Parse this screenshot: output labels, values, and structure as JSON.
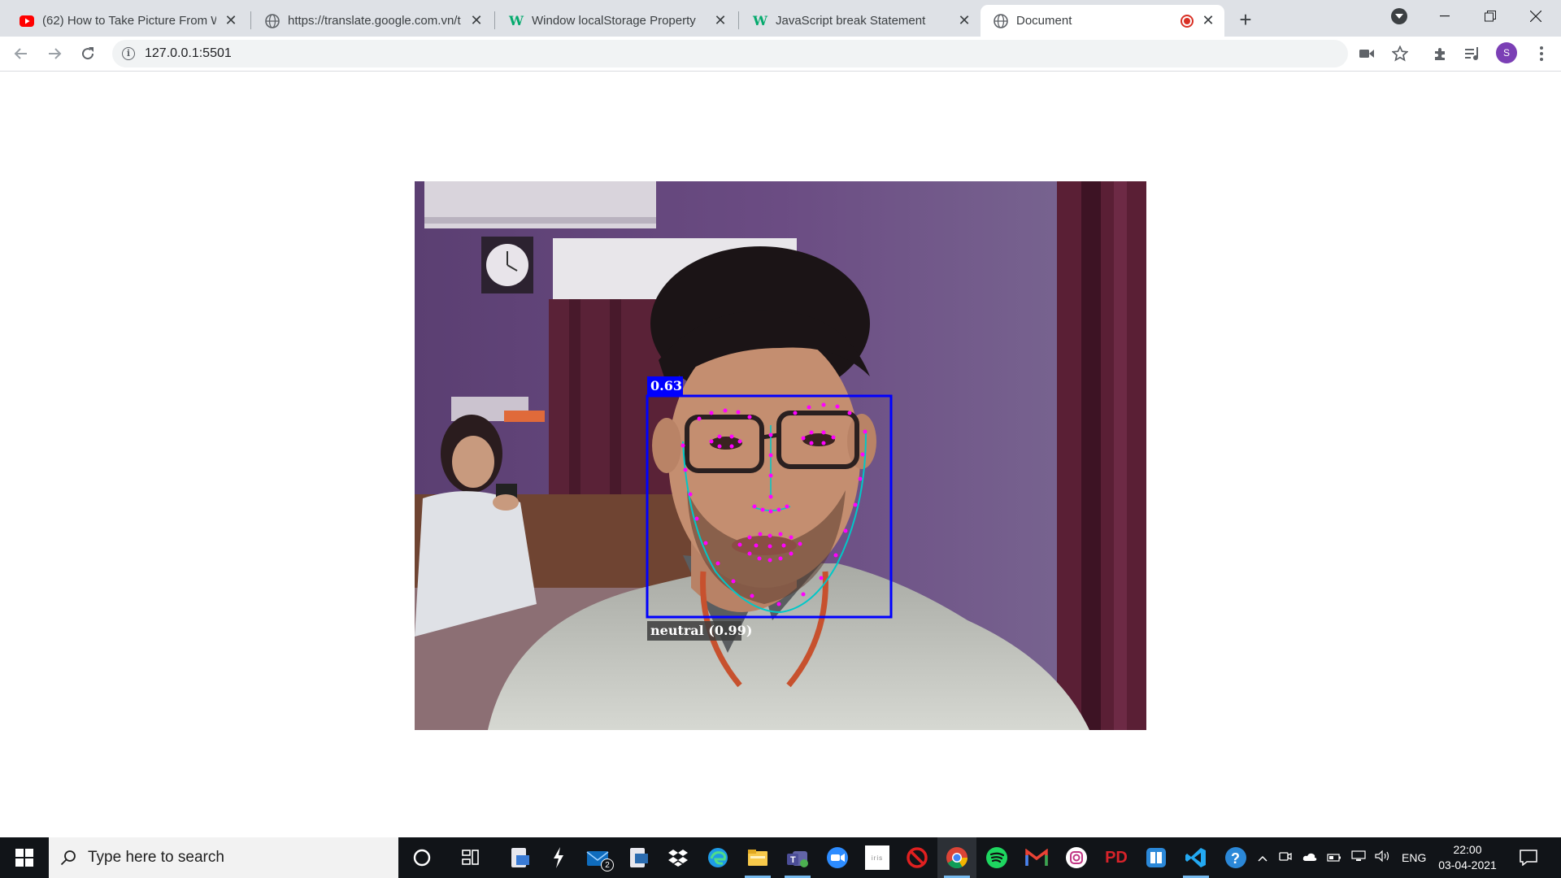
{
  "browser": {
    "tabs": [
      {
        "title": "(62) How to Take Picture From W",
        "favicon": "youtube-icon"
      },
      {
        "title": "https://translate.google.com.vn/t",
        "favicon": "globe-icon"
      },
      {
        "title": "Window localStorage Property",
        "favicon": "w3schools-icon"
      },
      {
        "title": "JavaScript break Statement",
        "favicon": "w3schools-icon"
      },
      {
        "title": "Document",
        "favicon": "globe-icon",
        "active": true,
        "recording": true
      }
    ],
    "new_tab_label": "+",
    "address": "127.0.0.1:5501",
    "profile_initial": "S"
  },
  "detection": {
    "score": "0.63",
    "expression": "neutral (0.99)",
    "box_color": "#0000ff",
    "landmark_color": "#ff00ff",
    "jaw_color": "#00c8c8"
  },
  "taskbar": {
    "search_placeholder": "Type here to search",
    "mail_badge": "2",
    "language": "ENG",
    "time": "22:00",
    "date": "03-04-2021",
    "pinned": [
      "cortana-icon",
      "task-view-icon",
      "pdf-reader-icon",
      "winamp-icon",
      "mail-icon",
      "pdf-editor-icon",
      "dropbox-icon",
      "edge-icon",
      "file-explorer-icon",
      "teams-icon",
      "zoom-icon",
      "iris-icon",
      "blocker-icon",
      "chrome-icon",
      "spotify-icon",
      "gmail-icon",
      "instagram-icon",
      "pdf-app-icon",
      "reader-app-icon",
      "vscode-icon",
      "help-icon"
    ]
  }
}
